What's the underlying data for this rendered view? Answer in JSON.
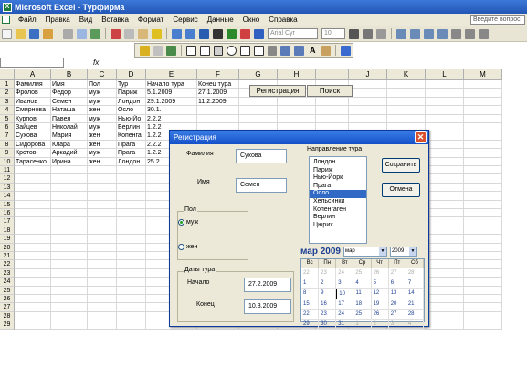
{
  "window": {
    "title": "Microsoft Excel - Турфирма"
  },
  "menu": {
    "items": [
      "Файл",
      "Правка",
      "Вид",
      "Вставка",
      "Формат",
      "Сервис",
      "Данные",
      "Окно",
      "Справка"
    ],
    "help_placeholder": "Введите вопрос"
  },
  "toolbar": {
    "font_name": "Arial Cyr",
    "font_size": "10"
  },
  "columns": [
    "A",
    "B",
    "C",
    "D",
    "E",
    "F",
    "G",
    "H",
    "I",
    "J",
    "K",
    "L",
    "M"
  ],
  "rows": [
    "1",
    "2",
    "3",
    "4",
    "5",
    "6",
    "7",
    "8",
    "9",
    "10",
    "11",
    "12",
    "13",
    "14",
    "15",
    "16",
    "17",
    "18",
    "19",
    "20",
    "21",
    "22",
    "23",
    "24",
    "25",
    "26",
    "27",
    "28",
    "29"
  ],
  "sheet": {
    "headers": [
      "Фамилия",
      "Имя",
      "Пол",
      "Тур",
      "Начало тура",
      "Конец тура"
    ],
    "data": [
      [
        "Фролов",
        "Федор",
        "муж",
        "Париж",
        "5.1.2009",
        "27.1.2009"
      ],
      [
        "Иванов",
        "Семен",
        "муж",
        "Лондон",
        "29.1.2009",
        "11.2.2009"
      ],
      [
        "Смирнова",
        "Наташа",
        "жен",
        "Осло",
        "30.1.",
        ""
      ],
      [
        "Курпов",
        "Павел",
        "муж",
        "Нью-Йо",
        "2.2.2",
        ""
      ],
      [
        "Зайцев",
        "Николай",
        "муж",
        "Берлин",
        "1.2.2",
        ""
      ],
      [
        "Сухова",
        "Мария",
        "жен",
        "Копенга",
        "1.2.2",
        ""
      ],
      [
        "Сидорова",
        "Клара",
        "жен",
        "Прага",
        "2.2.2",
        ""
      ],
      [
        "Кротов",
        "Аркадий",
        "муж",
        "Прага",
        "1.2.2",
        ""
      ],
      [
        "Тарасенко",
        "Ирина",
        "жен",
        "Лондон",
        "25.2.",
        ""
      ]
    ],
    "btn_register": "Регистрация",
    "btn_search": "Поиск"
  },
  "dialog": {
    "title": "Регистрация",
    "close_glyph": "✕",
    "lastname_label": "Фамилия",
    "lastname_value": "Сухова",
    "firstname_label": "Имя",
    "firstname_value": "Семен",
    "direction_label": "Направление тура",
    "directions": [
      "Лондон",
      "Париж",
      "Нью-Йорк",
      "Прага",
      "Осло",
      "Хельсинки",
      "Копенгаген",
      "Берлин",
      "Цюрих"
    ],
    "selected_direction": "Осло",
    "save_label": "Сохранить",
    "cancel_label": "Отмена",
    "gender_group": "Пол",
    "male_label": "муж",
    "female_label": "жен",
    "gender_selected": "муж",
    "dates_group": "Даты тура",
    "start_label": "Начало",
    "start_value": "27.2.2009",
    "end_label": "Конец",
    "end_value": "10.3.2009",
    "calendar": {
      "title": "мар 2009",
      "month_select": "мар",
      "year_select": "2009",
      "days_of_week": [
        "Вс",
        "Пн",
        "Вт",
        "Ср",
        "Чт",
        "Пт",
        "Сб"
      ],
      "weeks": [
        [
          "22",
          "23",
          "24",
          "25",
          "26",
          "27",
          "28"
        ],
        [
          "1",
          "2",
          "3",
          "4",
          "5",
          "6",
          "7"
        ],
        [
          "8",
          "9",
          "10",
          "11",
          "12",
          "13",
          "14"
        ],
        [
          "15",
          "16",
          "17",
          "18",
          "19",
          "20",
          "21"
        ],
        [
          "22",
          "23",
          "24",
          "25",
          "26",
          "27",
          "28"
        ],
        [
          "29",
          "30",
          "31",
          "1",
          "2",
          "3",
          "4"
        ]
      ],
      "today": "10"
    }
  }
}
